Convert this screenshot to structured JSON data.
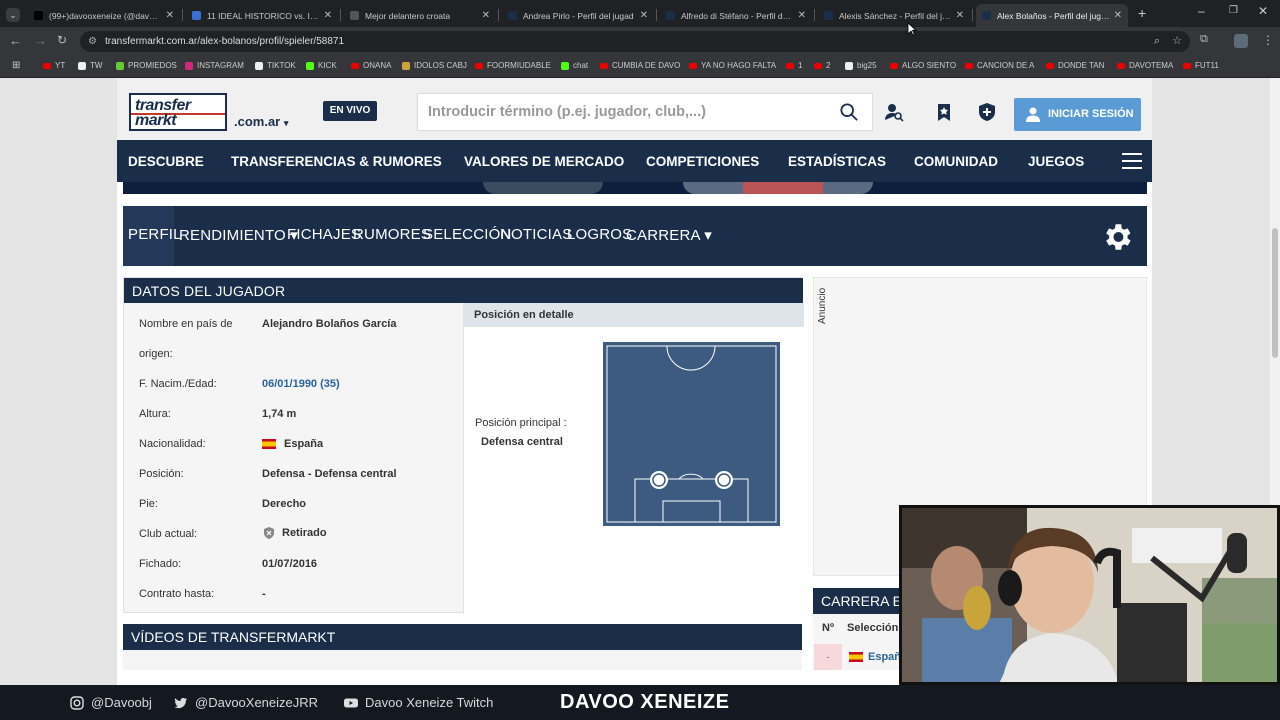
{
  "browser": {
    "tabs": [
      {
        "title": "(99+)davooxeneize (@davoox",
        "favicon": "tiktok",
        "color": "#000"
      },
      {
        "title": "11 IDEAL HISTORICO vs. INTEL",
        "favicon": "youtube",
        "color": "#3a6fd1"
      },
      {
        "title": "Mejor delantero croata",
        "favicon": "chatgpt",
        "color": "#555"
      },
      {
        "title": "Andrea Pirlo - Perfil del jugad",
        "favicon": "transfermarkt",
        "color": "#1a2e4a"
      },
      {
        "title": "Alfredo di Stéfano - Perfil del ju",
        "favicon": "transfermarkt",
        "color": "#1a2e4a"
      },
      {
        "title": "Alexis Sánchez - Perfil del juga",
        "favicon": "transfermarkt",
        "color": "#1a2e4a"
      },
      {
        "title": "Alex Bolaños - Perfil del jugad",
        "favicon": "transfermarkt",
        "color": "#1a2e4a"
      }
    ],
    "new_tab": "+",
    "url": "transfermarkt.com.ar/alex-bolanos/profil/spieler/58871",
    "bookmarks": [
      {
        "label": "YT",
        "icon": "youtube"
      },
      {
        "label": "TW",
        "icon": "x"
      },
      {
        "label": "PROMIEDOS",
        "icon": "promiedos"
      },
      {
        "label": "INSTAGRAM",
        "icon": "instagram"
      },
      {
        "label": "TIKTOK",
        "icon": "tiktok"
      },
      {
        "label": "KICK",
        "icon": "kick"
      },
      {
        "label": "ONANA",
        "icon": "youtube"
      },
      {
        "label": "IDOLOS CABJ",
        "icon": "folder"
      },
      {
        "label": "FOORMIUDABLE",
        "icon": "youtube"
      },
      {
        "label": "chat",
        "icon": "kick"
      },
      {
        "label": "CUMBIA DE DAVO",
        "icon": "youtube"
      },
      {
        "label": "YA NO HAGO FALTA",
        "icon": "youtube"
      },
      {
        "label": "1",
        "icon": "youtube"
      },
      {
        "label": "2",
        "icon": "youtube"
      },
      {
        "label": "big25",
        "icon": "x"
      },
      {
        "label": "ALGO SIENTO",
        "icon": "youtube"
      },
      {
        "label": "CANCION DE A",
        "icon": "youtube"
      },
      {
        "label": "DONDE TAN",
        "icon": "youtube"
      },
      {
        "label": "DAVOTEMA",
        "icon": "youtube"
      },
      {
        "label": "FUT11",
        "icon": "youtube"
      }
    ]
  },
  "site": {
    "logo_line1": "transfer",
    "logo_line2": "markt",
    "domain": ".com.ar",
    "domain_caret": "▾",
    "live": "EN VIVO",
    "search_placeholder": "Introducir término (p.ej. jugador, club,...)",
    "login": "INICIAR SESIÓN",
    "main_nav": [
      "DESCUBRE",
      "TRANSFERENCIAS & RUMORES",
      "VALORES DE MERCADO",
      "COMPETICIONES",
      "ESTADÍSTICAS",
      "COMUNIDAD",
      "JUEGOS"
    ],
    "sub_nav": [
      "PERFIL",
      "RENDIMIENTO ▾",
      "FICHAJES",
      "RUMORES",
      "SELECCIÓN",
      "NOTICIAS",
      "LOGROS",
      "CARRERA ▾"
    ]
  },
  "player": {
    "section_title": "DATOS DEL JUGADOR",
    "rows": [
      {
        "label": "Nombre en país de",
        "label2": "origen:",
        "value": "Alejandro Bolaños García"
      },
      {
        "label": "F. Nacim./Edad:",
        "value": "06/01/1990 (35)",
        "link": true
      },
      {
        "label": "Altura:",
        "value": "1,74 m"
      },
      {
        "label": "Nacionalidad:",
        "value": "España",
        "flag": "spain"
      },
      {
        "label": "Posición:",
        "value": "Defensa - Defensa central"
      },
      {
        "label": "Pie:",
        "value": "Derecho"
      },
      {
        "label": "Club actual:",
        "value": "Retirado",
        "icon": "retired-club"
      },
      {
        "label": "Fichado:",
        "value": "01/07/2016"
      },
      {
        "label": "Contrato hasta:",
        "value": "-"
      }
    ],
    "position_header": "Posición en detalle",
    "position_main_label": "Posición principal :",
    "position_main_value": "Defensa central"
  },
  "videos_title": "VÍDEOS DE TRANSFERMARKT",
  "ad_label": "Anuncio",
  "career": {
    "title": "CARRERA EN",
    "col_no": "Nº",
    "col_sel": "Selección",
    "row_team": "Españ",
    "row_no": "-"
  },
  "footer": {
    "instagram": "@Davoobj",
    "twitter": "@DavooXeneizeJRR",
    "youtube": "Davoo Xeneize Twitch",
    "brand": "DAVOO XENEIZE"
  },
  "colors": {
    "navy": "#1a2e4a",
    "login_blue": "#5b9bd5",
    "link": "#2a6496",
    "pitch": "#3d5a80"
  }
}
